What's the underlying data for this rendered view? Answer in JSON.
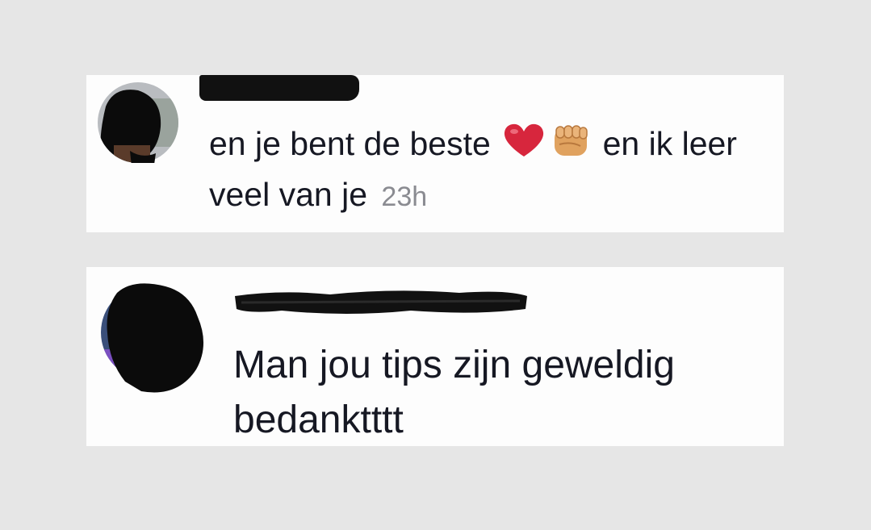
{
  "comments": [
    {
      "text_part1": "en je bent de beste",
      "emojis": [
        "red-heart-emoji",
        "fist-emoji"
      ],
      "text_part2": "en ik leer veel van je",
      "timestamp": "23h"
    },
    {
      "text": "Man jou tips zijn geweldig bedanktttt"
    }
  ],
  "colors": {
    "background": "#e6e6e6",
    "card": "#fdfdfd",
    "text": "#161823",
    "timestamp": "#8a8b91",
    "redaction": "#111111",
    "heart": "#d7263d",
    "fist": "#e0a25f"
  }
}
